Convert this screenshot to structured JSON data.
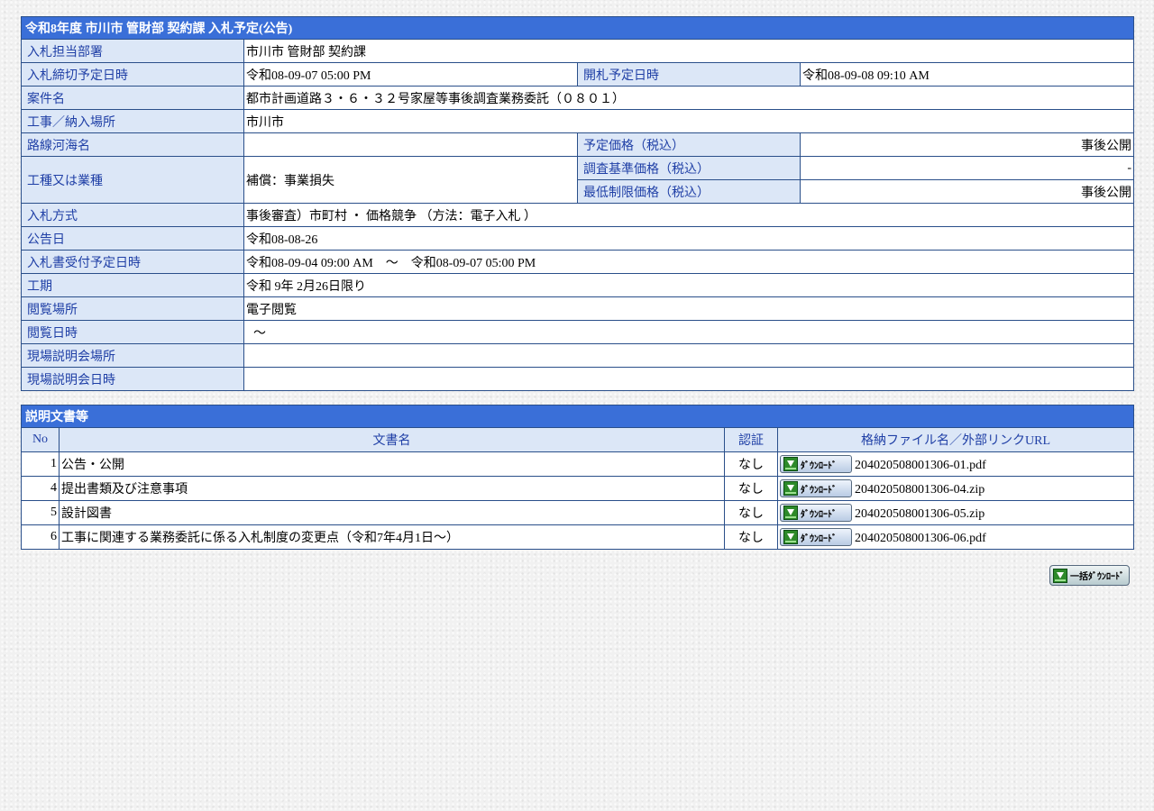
{
  "notice": {
    "title": "令和8年度 市川市 管財部 契約課 入札予定(公告)",
    "dept": {
      "label": "入札担当部署",
      "value": "市川市 管財部 契約課"
    },
    "deadline": {
      "label": "入札締切予定日時",
      "value": "令和08-09-07 05:00 PM"
    },
    "opening": {
      "label": "開札予定日時",
      "value": "令和08-09-08 09:10 AM"
    },
    "case_name": {
      "label": "案件名",
      "value": "都市計画道路３・６・３２号家屋等事後調査業務委託（０８０１）"
    },
    "location": {
      "label": "工事／納入場所",
      "value": "市川市"
    },
    "route": {
      "label": "路線河海名",
      "value": ""
    },
    "planned_price": {
      "label": "予定価格（税込）",
      "value": "事後公開"
    },
    "work_type": {
      "label": "工種又は業種",
      "value": "補償：事業損失"
    },
    "survey_price": {
      "label": "調査基準価格（税込）",
      "value": "-"
    },
    "min_price": {
      "label": "最低制限価格（税込）",
      "value": "事後公開"
    },
    "method": {
      "label": "入札方式",
      "value": "事後審査）市町村 ・ 価格競争 （方法：電子入札 ）"
    },
    "announce_date": {
      "label": "公告日",
      "value": "令和08-08-26"
    },
    "receipt_period": {
      "label": "入札書受付予定日時",
      "value": "令和08-09-04 09:00 AM　～　令和08-09-07 05:00 PM"
    },
    "work_period": {
      "label": "工期",
      "value": "令和 9年 2月26日限り"
    },
    "view_place": {
      "label": "閲覧場所",
      "value": "電子閲覧"
    },
    "view_datetime": {
      "label": "閲覧日時",
      "value": "～"
    },
    "briefing_place": {
      "label": "現場説明会場所",
      "value": ""
    },
    "briefing_datetime": {
      "label": "現場説明会日時",
      "value": ""
    }
  },
  "docs": {
    "title": "説明文書等",
    "columns": {
      "no": "No",
      "name": "文書名",
      "auth": "認証",
      "file": "格納ファイル名／外部リンクURL"
    },
    "download_label": "ﾀﾞｳﾝﾛｰﾄﾞ",
    "rows": [
      {
        "no": "1",
        "name": "公告・公開",
        "auth": "なし",
        "file": "204020508001306-01.pdf"
      },
      {
        "no": "4",
        "name": "提出書類及び注意事項",
        "auth": "なし",
        "file": "204020508001306-04.zip"
      },
      {
        "no": "5",
        "name": "設計図書",
        "auth": "なし",
        "file": "204020508001306-05.zip"
      },
      {
        "no": "6",
        "name": "工事に関連する業務委託に係る入札制度の変更点（令和7年4月1日～）",
        "auth": "なし",
        "file": "204020508001306-06.pdf"
      }
    ],
    "bulk_download_label": "一括ﾀﾞｳﾝﾛｰﾄﾞ"
  },
  "colors": {
    "header_bg": "#3a6fd8",
    "label_bg": "#dce7f7",
    "label_text": "#1f3fa6",
    "border": "#2a4f8a"
  },
  "icons": {
    "download": "green-download-arrow-icon"
  }
}
